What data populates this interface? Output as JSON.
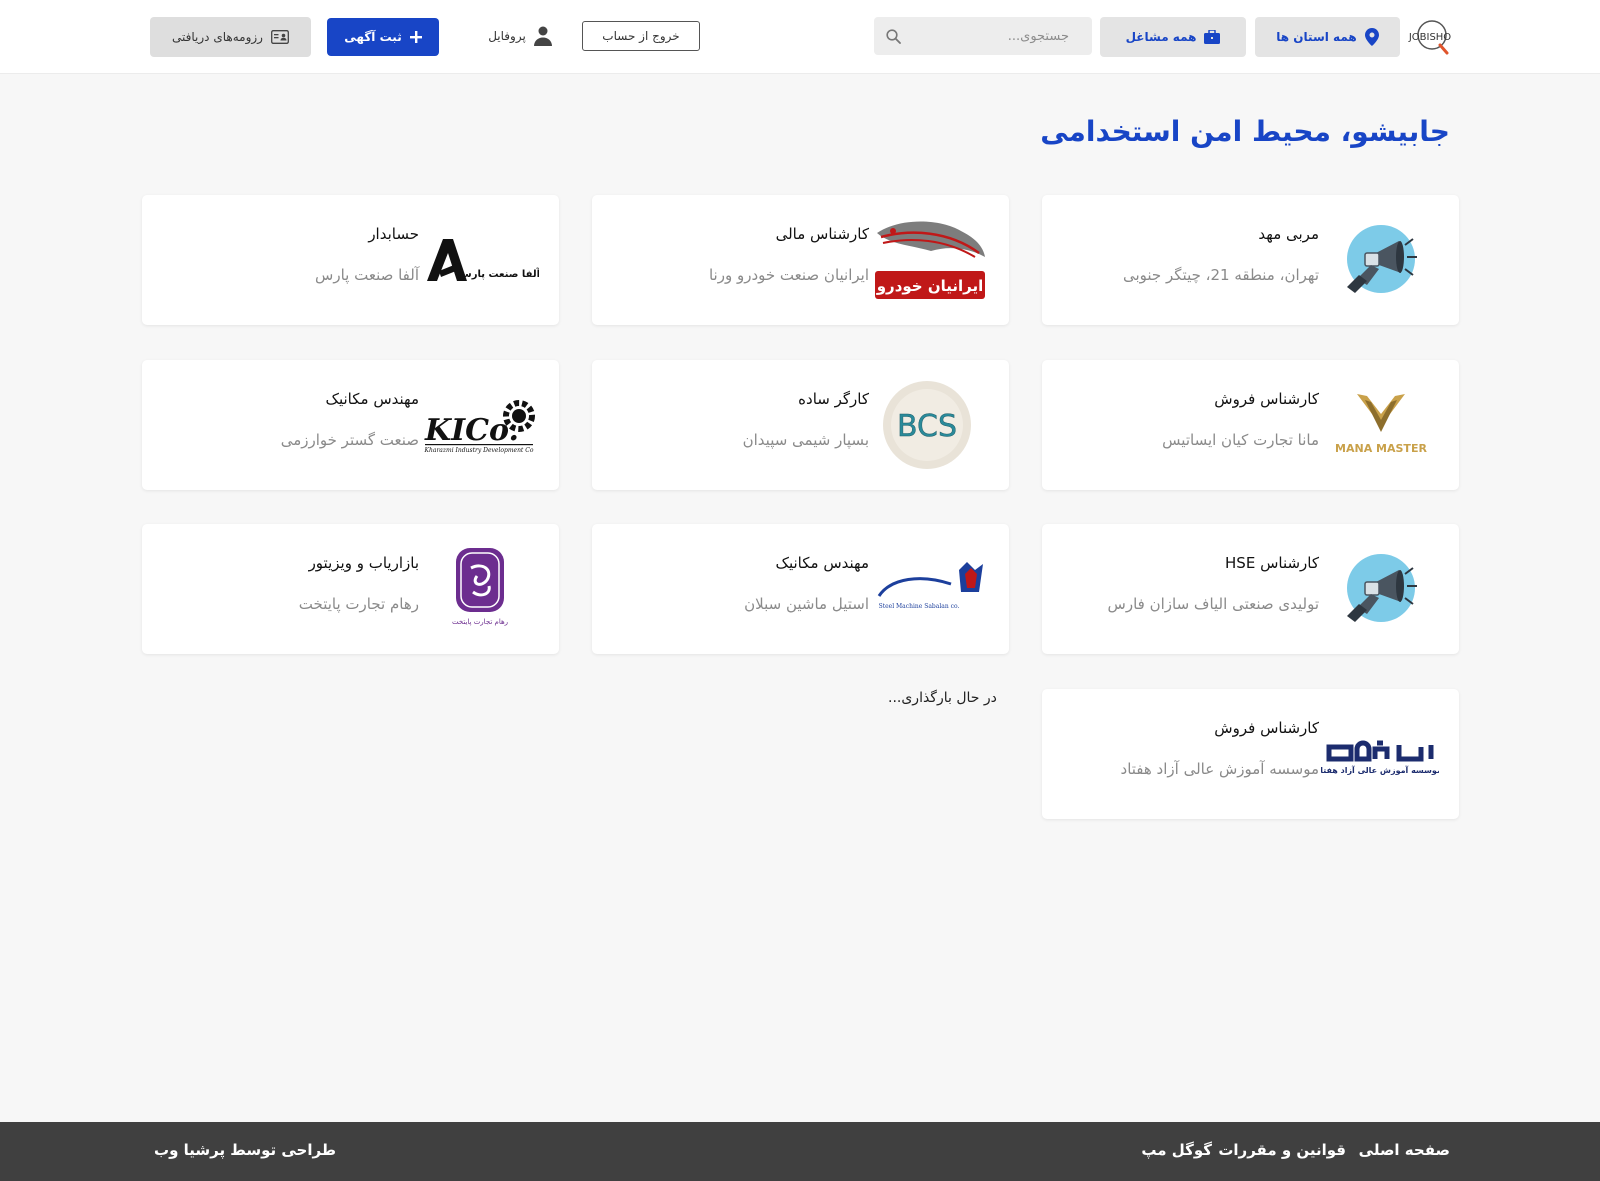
{
  "header": {
    "province_button": "همه استان ها",
    "occupation_button": "همه مشاغل",
    "search_placeholder": "جستجوی...",
    "logout_button": "خروج از حساب",
    "profile_link": "پروفایل",
    "post_ad_button": "ثبت آگهی",
    "resumes_button": "رزومه‌های دریافتی",
    "logo_text": "JOBISHO"
  },
  "page": {
    "title": "جابیشو، محیط امن استخدامی",
    "loading_text": "در حال بارگذاری..."
  },
  "jobs": [
    {
      "title": "مربی مهد",
      "company": "تهران، منطقه 21، چیتگر جنوبی",
      "logo": "megaphone-logo"
    },
    {
      "title": "کارشناس مالی",
      "company": "ایرانیان صنعت خودرو ورنا",
      "logo": "iranian-khodro-logo",
      "logo_text": "ایرانیان خودرو"
    },
    {
      "title": "حسابدار",
      "company": "آلفا صنعت پارس",
      "logo": "alfa-sanat-pars-logo",
      "logo_text": "آلفا صنعت پارس"
    },
    {
      "title": "کارشناس فروش",
      "company": "مانا تجارت کیان ایساتیس",
      "logo": "mana-master-logo",
      "logo_text": "MANA MASTER"
    },
    {
      "title": "کارگر ساده",
      "company": "بسپار شیمی سپیدان",
      "logo": "bcs-logo",
      "logo_text": "BCS"
    },
    {
      "title": "مهندس مکانیک",
      "company": "صنعت گستر خوارزمی",
      "logo": "kico-logo",
      "logo_text": "KICo.",
      "logo_subtext": "Kharazmi Industry Development Co"
    },
    {
      "title": "کارشناس HSE",
      "company": "تولیدی صنعتی الیاف سازان فارس",
      "logo": "megaphone-logo"
    },
    {
      "title": "مهندس مکانیک",
      "company": "استیل ماشین سبلان",
      "logo": "steel-machine-sabalan-logo",
      "logo_text": "Steel Machine Sabalan co."
    },
    {
      "title": "بازاریاب و ویزیتور",
      "company": "رهام تجارت پایتخت",
      "logo": "raham-logo",
      "logo_text": "رهام تجارت پایتخت"
    },
    {
      "title": "کارشناس فروش",
      "company": "موسسه آموزش عالی آزاد هفتاد",
      "logo": "haftad-logo",
      "logo_text": "موسسه آموزش عالی آزاد هفتاد"
    }
  ],
  "footer": {
    "home": "صفحه اصلی",
    "rules": "قوانین و مقررات",
    "google_map": "گوگل مپ",
    "credit": "طراحی توسط پرشیا وب"
  },
  "colors": {
    "brand_blue": "#1845c6",
    "footer_bg": "#404040",
    "page_bg": "#f7f7f7"
  }
}
